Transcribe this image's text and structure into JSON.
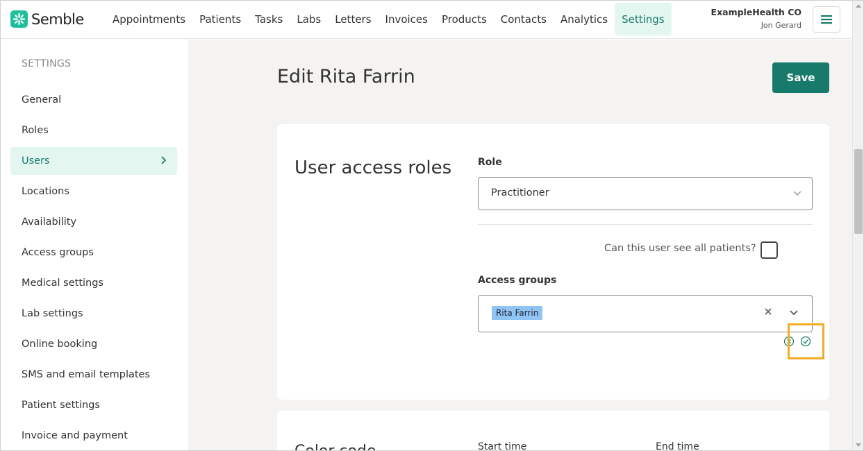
{
  "app": {
    "logo_text": "Semble"
  },
  "nav": {
    "items": [
      {
        "label": "Appointments"
      },
      {
        "label": "Patients"
      },
      {
        "label": "Tasks"
      },
      {
        "label": "Labs"
      },
      {
        "label": "Letters"
      },
      {
        "label": "Invoices"
      },
      {
        "label": "Products"
      },
      {
        "label": "Contacts"
      },
      {
        "label": "Analytics"
      },
      {
        "label": "Settings",
        "active": true
      }
    ]
  },
  "header": {
    "org_name": "ExampleHealth CO",
    "user_name": "Jon Gerard",
    "menu_icon": "hamburger-icon"
  },
  "sidebar": {
    "title": "SETTINGS",
    "items": [
      {
        "label": "General"
      },
      {
        "label": "Roles"
      },
      {
        "label": "Users",
        "active": true
      },
      {
        "label": "Locations"
      },
      {
        "label": "Availability"
      },
      {
        "label": "Access groups"
      },
      {
        "label": "Medical settings"
      },
      {
        "label": "Lab settings"
      },
      {
        "label": "Online booking"
      },
      {
        "label": "SMS and email templates"
      },
      {
        "label": "Patient settings"
      },
      {
        "label": "Invoice and payment"
      }
    ]
  },
  "main": {
    "title": "Edit Rita Farrin",
    "save_label": "Save",
    "section_title": "User access roles",
    "role_label": "Role",
    "role_value": "Practitioner",
    "see_all_question": "Can this user see all patients?",
    "see_all_checked": false,
    "access_groups_label": "Access groups",
    "access_groups_tags": [
      "Rita Farrin"
    ],
    "next_section_title": "Color code",
    "start_time_label": "Start time",
    "end_time_label": "End time"
  },
  "colors": {
    "brand": "#177a6b",
    "brand_light": "#e3f6f0",
    "logo": "#1fbf9a",
    "highlight": "#f0ad23",
    "tag": "#8fc4f5"
  }
}
